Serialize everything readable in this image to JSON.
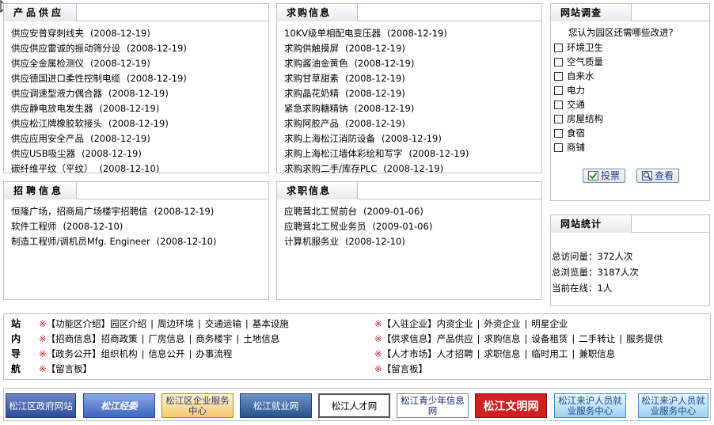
{
  "supply": {
    "title": "产品供应",
    "items": [
      {
        "text": "供应安普穿刺线夹",
        "date": "(2008-12-19)"
      },
      {
        "text": "供应供应雷诚的振动筛分设",
        "date": "(2008-12-19)"
      },
      {
        "text": "供应全金属检测仪",
        "date": "(2008-12-19)"
      },
      {
        "text": "供应德国进口柔性控制电缆",
        "date": "(2008-12-19)"
      },
      {
        "text": "供应调速型液力偶合器",
        "date": "(2008-12-19)"
      },
      {
        "text": "供应静电放电发生器",
        "date": "(2008-12-19)"
      },
      {
        "text": "供应松江牌橡胶软接头",
        "date": "(2008-12-19)"
      },
      {
        "text": "供应应用安全产品",
        "date": "(2008-12-19)"
      },
      {
        "text": "供应USB吸尘器",
        "date": "(2008-12-19)"
      },
      {
        "text": "碳纤维平纹（平纹）",
        "date": "(2008-12-10)"
      }
    ]
  },
  "demand": {
    "title": "求购信息",
    "items": [
      {
        "text": "10KV级单相配电变压器",
        "date": "(2008-12-19)"
      },
      {
        "text": "求购供触摸屏",
        "date": "(2008-12-19)"
      },
      {
        "text": "求购酱油金黄色",
        "date": "(2008-12-19)"
      },
      {
        "text": "求购甘草甜素",
        "date": "(2008-12-19)"
      },
      {
        "text": "求购晶花奶精",
        "date": "(2008-12-19)"
      },
      {
        "text": "紧急求购糖精钠",
        "date": "(2008-12-19)"
      },
      {
        "text": "求购阿胶产品",
        "date": "(2008-12-19)"
      },
      {
        "text": "求购上海松江消防设备",
        "date": "(2008-12-19)"
      },
      {
        "text": "求购上海松江墙体彩绘和写字",
        "date": "(2008-12-19)"
      },
      {
        "text": "求购求购二手/库存PLC",
        "date": "(2008-12-19)"
      }
    ]
  },
  "recruit": {
    "title": "招聘信息",
    "items": [
      {
        "text": "恒隆广场，招商局广场楼宇招聘信",
        "date": "(2008-12-19)"
      },
      {
        "text": "软件工程师",
        "date": "(2008-12-10)"
      },
      {
        "text": "制造工程师/调机员Mfg. Engineer",
        "date": "(2008-12-10)"
      }
    ]
  },
  "jobs": {
    "title": "求职信息",
    "items": [
      {
        "text": "应聘茸北工贸前台",
        "date": "(2009-01-06)"
      },
      {
        "text": "应聘茸北工贸业务员",
        "date": "(2009-01-06)"
      },
      {
        "text": "计算机服务业",
        "date": "(2008-12-10)"
      }
    ]
  },
  "survey": {
    "title": "网站调查",
    "question": "您认为园区还需哪些改进?",
    "options": [
      "环境卫生",
      "空气质量",
      "自来水",
      "电力",
      "交通",
      "房屋结构",
      "食宿",
      "商铺"
    ],
    "vote_label": "投票",
    "view_label": "查看"
  },
  "stats": {
    "title": "网站统计",
    "total_visits": "总访问量：372人次",
    "total_views": "总浏览量：3187人次",
    "online": "当前在线：1人"
  },
  "site_nav": {
    "label_chars": [
      "站",
      "内",
      "导",
      "航"
    ],
    "star": "※",
    "rows_left": [
      {
        "head": "【功能区介绍】",
        "items": [
          "园区介绍",
          "周边环境",
          "交通运输",
          "基本设施"
        ]
      },
      {
        "head": "【招商信息】",
        "items": [
          "招商政策",
          "厂房信息",
          "商务楼宇",
          "土地信息"
        ]
      },
      {
        "head": "【政务公开】",
        "items": [
          "组织机构",
          "信息公开",
          "办事流程"
        ]
      },
      {
        "head": "【留言板】",
        "items": []
      }
    ],
    "rows_right": [
      {
        "head": "【入驻企业】",
        "items": [
          "内资企业",
          "外资企业",
          "明星企业"
        ]
      },
      {
        "head": "【供求信息】",
        "items": [
          "产品供应",
          "求购信息",
          "设备租赁",
          "二手转让",
          "服务提供"
        ]
      },
      {
        "head": "【人才市场】",
        "items": [
          "人才招聘",
          "求职信息",
          "临时用工",
          "兼职信息"
        ]
      },
      {
        "head": "【留言板】",
        "items": []
      }
    ]
  },
  "partner_links": [
    "松江区政府网站",
    "松江经委",
    "松江区企业服务中心",
    "松江就业网",
    "松江人才网",
    "松江青少年信息网",
    "松江文明网",
    "松江来沪人员就业服务中心",
    "松江来沪人员就业服务中心"
  ],
  "colors": {
    "border": "#b8c4d0",
    "star": "#d02020",
    "button_text": "#223c80"
  }
}
